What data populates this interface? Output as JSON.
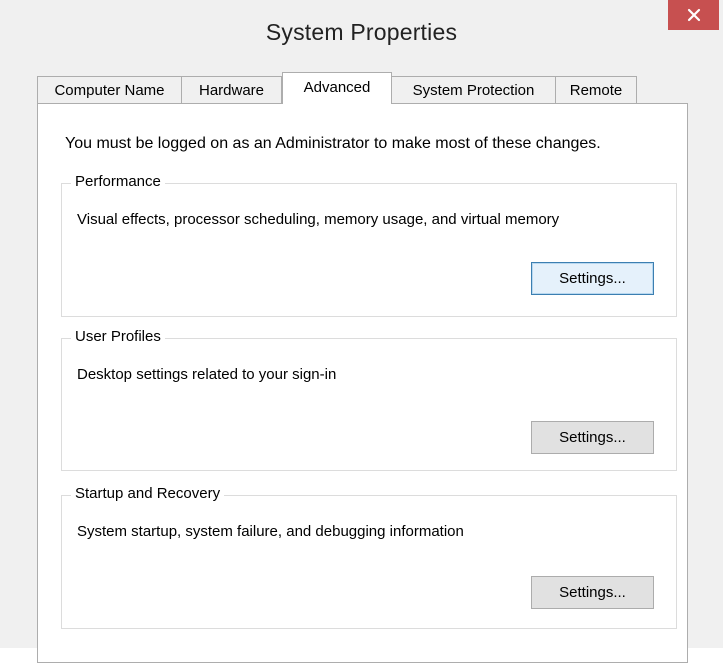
{
  "window": {
    "title": "System Properties",
    "close_glyph": "✕"
  },
  "tabs": [
    {
      "label": "Computer Name",
      "active": false
    },
    {
      "label": "Hardware",
      "active": false
    },
    {
      "label": "Advanced",
      "active": true
    },
    {
      "label": "System Protection",
      "active": false
    },
    {
      "label": "Remote",
      "active": false
    }
  ],
  "notice": "You must be logged on as an Administrator to make most of these changes.",
  "groups": {
    "performance": {
      "legend": "Performance",
      "description": "Visual effects, processor scheduling, memory usage, and virtual memory",
      "button": "Settings..."
    },
    "user_profiles": {
      "legend": "User Profiles",
      "description": "Desktop settings related to your sign-in",
      "button": "Settings..."
    },
    "startup_recovery": {
      "legend": "Startup and Recovery",
      "description": "System startup, system failure, and debugging information",
      "button": "Settings..."
    }
  },
  "colors": {
    "close_button": "#c75050",
    "chrome": "#f0f0f0",
    "panel": "#ffffff",
    "default_button_border": "#3c7fb1"
  }
}
